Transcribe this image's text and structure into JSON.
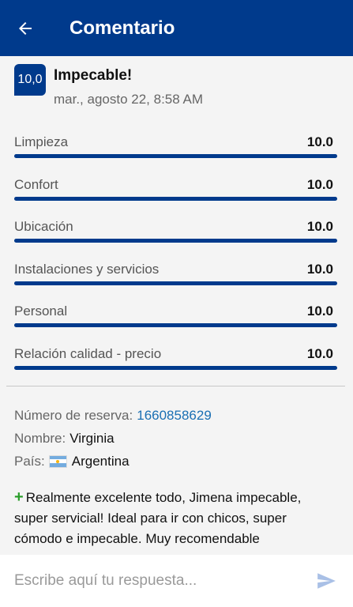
{
  "appbar": {
    "title": "Comentario",
    "back_icon": "arrow-left-icon"
  },
  "review": {
    "score": "10,0",
    "title": "Impecable!",
    "date": "mar., agosto 22, 8:58 AM"
  },
  "ratings": [
    {
      "label": "Limpieza",
      "value": "10.0",
      "fill": 1.0
    },
    {
      "label": "Confort",
      "value": "10.0",
      "fill": 1.0
    },
    {
      "label": "Ubicación",
      "value": "10.0",
      "fill": 1.0
    },
    {
      "label": "Instalaciones y servicios",
      "value": "10.0",
      "fill": 1.0
    },
    {
      "label": "Personal",
      "value": "10.0",
      "fill": 1.0
    },
    {
      "label": "Relación calidad - precio",
      "value": "10.0",
      "fill": 1.0
    }
  ],
  "info": {
    "reservation_label": "Número de reserva:",
    "reservation_number": "1660858629",
    "name_label": "Nombre:",
    "name_value": "Virginia",
    "country_label": "País:",
    "country_flag": "argentina-flag-icon",
    "country_value": "Argentina"
  },
  "comment": {
    "icon": "plus-icon",
    "sign": "+",
    "text": "Realmente excelente todo, Jimena impecable, super servicial! Ideal para ir con chicos, super cómodo e impecable. Muy recomendable"
  },
  "reply": {
    "placeholder": "Escribe aquí tu respuesta...",
    "send_icon": "send-icon"
  },
  "colors": {
    "primary": "#003a8c",
    "link": "#1a6fb3",
    "positive": "#2a9d2a"
  }
}
